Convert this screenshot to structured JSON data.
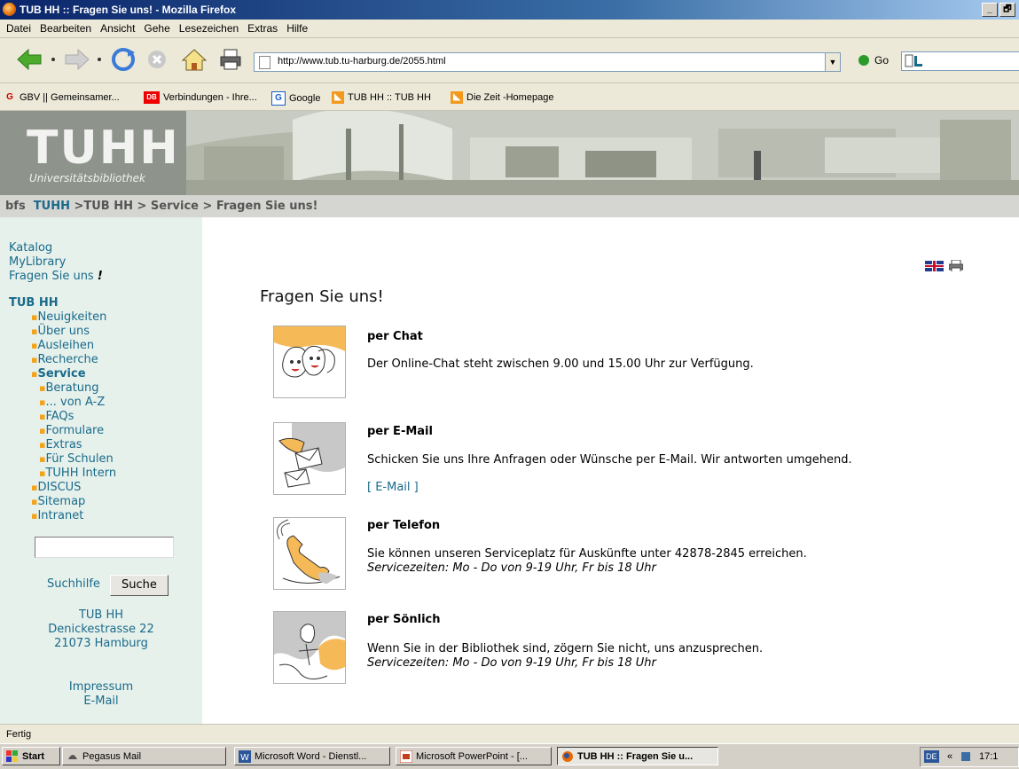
{
  "window": {
    "title": "TUB HH :: Fragen Sie uns! - Mozilla Firefox",
    "controls": [
      "_",
      "🗗"
    ]
  },
  "menubar": {
    "items": [
      "Datei",
      "Bearbeiten",
      "Ansicht",
      "Gehe",
      "Lesezeichen",
      "Extras",
      "Hilfe"
    ]
  },
  "toolbar": {
    "url": "http://www.tub.tu-harburg.de/2055.html",
    "go_label": "Go"
  },
  "bookmarks": [
    {
      "icon": "G",
      "label": "GBV || Gemeinsamer..."
    },
    {
      "icon": "DB",
      "label": "Verbindungen - Ihre..."
    },
    {
      "icon": "G",
      "label": "Google"
    },
    {
      "icon": "rss",
      "label": "TUB HH :: TUB HH"
    },
    {
      "icon": "rss",
      "label": "Die Zeit -Homepage"
    }
  ],
  "header": {
    "logo": "TUHH",
    "logo_sub": "Universitätsbibliothek"
  },
  "breadcrumb": {
    "prefix": "bfs",
    "link": "TUHH",
    "rest": " >TUB HH > Service > Fragen Sie uns!"
  },
  "sidebar": {
    "top_links": [
      "Katalog",
      "MyLibrary",
      "Fragen Sie uns"
    ],
    "fragen_mark": "!",
    "section_title": "TUB HH",
    "items": [
      "Neuigkeiten",
      "Über uns",
      "Ausleihen",
      "Recherche",
      "Service"
    ],
    "subitems": [
      "Beratung",
      "... von A-Z",
      "FAQs",
      "Formulare",
      "Extras",
      "Für Schulen",
      "TUHH Intern"
    ],
    "items2": [
      "DISCUS",
      "Sitemap",
      "Intranet"
    ],
    "search_help": "Suchhilfe",
    "search_button": "Suche",
    "address": [
      "TUB HH",
      "Denickestrasse 22",
      "21073 Hamburg"
    ],
    "footer": [
      "Impressum",
      "E-Mail"
    ]
  },
  "content": {
    "title": "Fragen Sie uns!",
    "services": [
      {
        "title": "per Chat",
        "text": "Der Online-Chat steht zwischen 9.00 und 15.00 Uhr zur Verfügung.",
        "note": ""
      },
      {
        "title": "per E-Mail",
        "text": "Schicken Sie uns Ihre Anfragen oder Wünsche per E-Mail. Wir antworten umgehend.",
        "note": "",
        "link": "[ E-Mail ]"
      },
      {
        "title": "per Telefon",
        "text": "Sie können unseren Serviceplatz für Auskünfte unter 42878-2845 erreichen.",
        "note": "Servicezeiten: Mo - Do von 9-19 Uhr, Fr bis 18 Uhr"
      },
      {
        "title": "per Sönlich",
        "text": "Wenn Sie in der Bibliothek sind, zögern Sie nicht, uns anzusprechen.",
        "note": "Servicezeiten: Mo - Do von 9-19 Uhr, Fr bis 18 Uhr"
      }
    ]
  },
  "statusbar": {
    "text": "Fertig"
  },
  "taskbar": {
    "start": "Start",
    "tasks": [
      "Pegasus Mail",
      "Microsoft Word - Dienstl...",
      "Microsoft PowerPoint - [...",
      "TUB HH :: Fragen Sie u..."
    ],
    "lang": "DE",
    "clock": "17:1"
  },
  "colors": {
    "link": "#1a6a8a",
    "bullet": "#f2a31b",
    "sidebar_bg": "#e6f1ec",
    "breadcrumb_bg": "#d5d5d2"
  }
}
